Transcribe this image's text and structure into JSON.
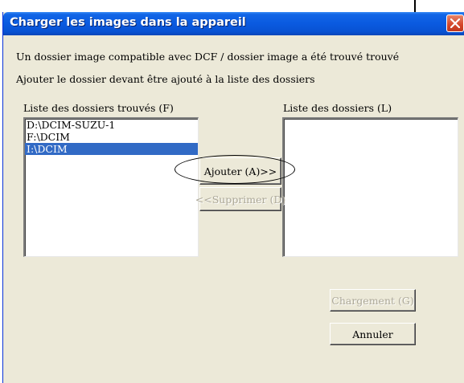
{
  "window": {
    "title": "Charger les images dans la appareil",
    "close_icon": "close-icon"
  },
  "messages": {
    "line1": "Un dossier image compatible avec DCF / dossier image a été trouvé trouvé",
    "line2": "Ajouter le dossier devant être ajouté à la liste des dossiers"
  },
  "found_list": {
    "label": "Liste des dossiers trouvés (F)",
    "items": [
      "D:\\DCIM-SUZU-1",
      "F:\\DCIM",
      "I:\\DCIM"
    ],
    "selected_index": 2
  },
  "folder_list": {
    "label": "Liste des dossiers (L)",
    "items": []
  },
  "buttons": {
    "add": "Ajouter (A)>>",
    "remove": "<<Supprimer (D)",
    "load": "Chargement (G)",
    "cancel": "Annuler"
  },
  "colors": {
    "titlebar": "#0a5ae0",
    "selection": "#316ac5",
    "dialog_bg": "#ece9d8",
    "close": "#d4462a"
  }
}
